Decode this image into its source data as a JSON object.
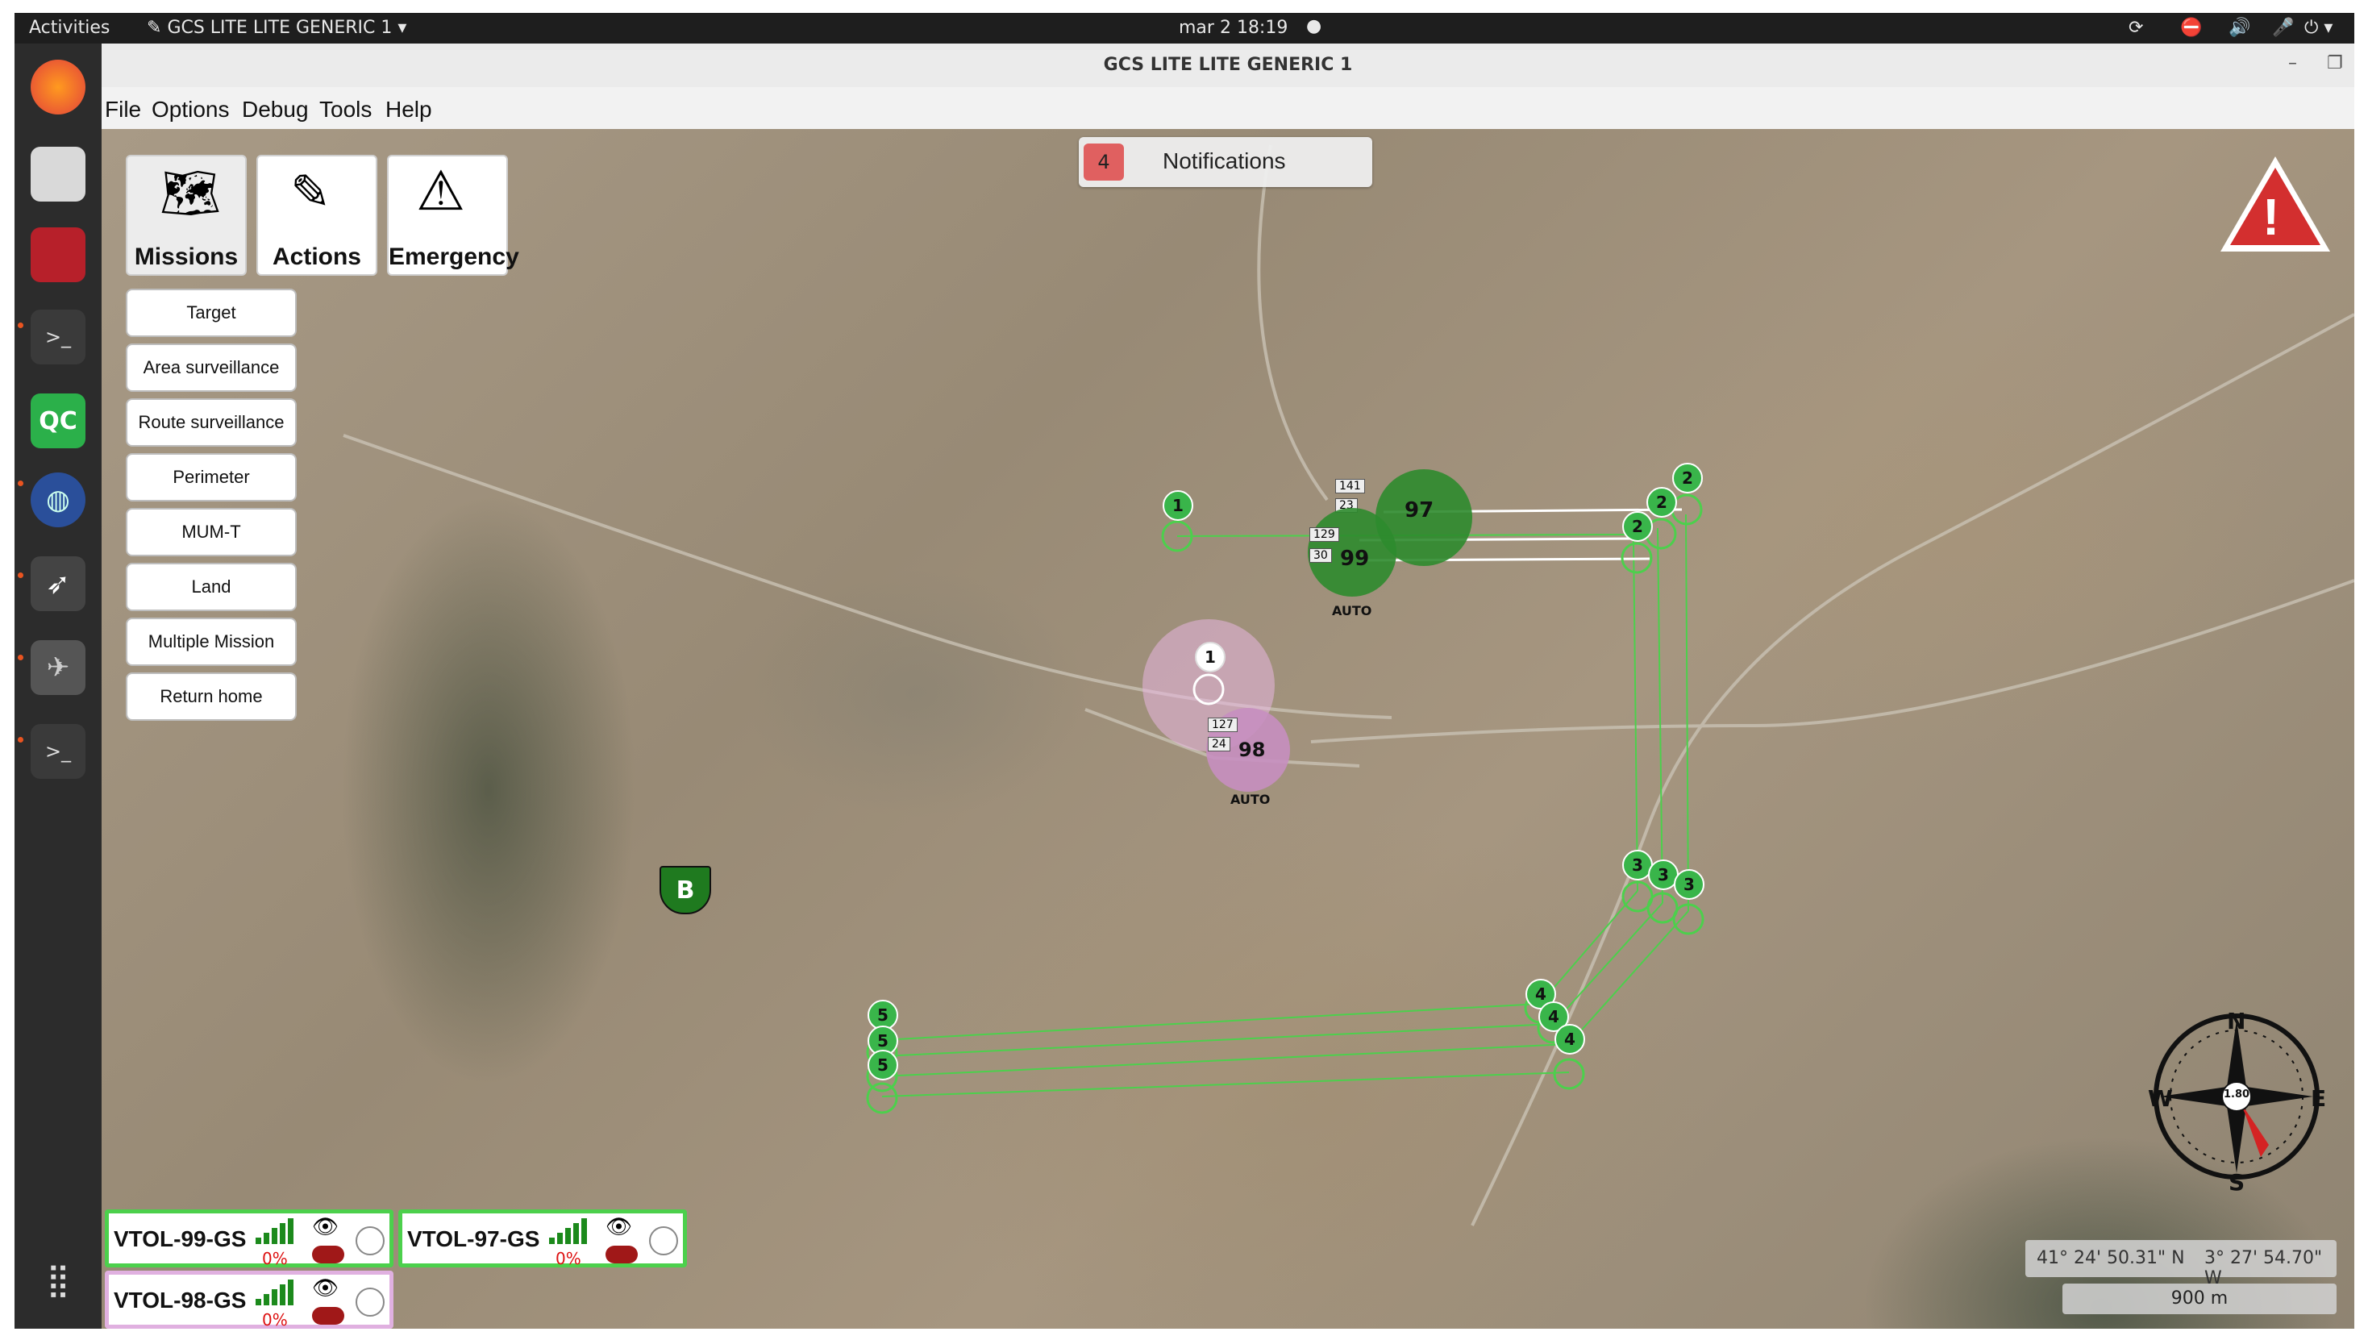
{
  "topbar": {
    "activities": "Activities",
    "app_menu": "GCS LITE LITE GENERIC 1",
    "clock": "mar 2  18:19"
  },
  "window": {
    "title": "GCS LITE LITE GENERIC 1"
  },
  "menu": [
    "File",
    "Options",
    "Debug",
    "Tools",
    "Help"
  ],
  "tool_tabs": [
    {
      "label": "Missions",
      "icon": "map-pin-icon",
      "active": true
    },
    {
      "label": "Actions",
      "icon": "edit-icon",
      "active": false
    },
    {
      "label": "Emergency",
      "icon": "warning-icon",
      "active": false
    }
  ],
  "missions": [
    "Target",
    "Area surveillance",
    "Route surveillance",
    "Perimeter",
    "MUM-T",
    "Land",
    "Multiple Mission",
    "Return home"
  ],
  "notifications": {
    "count": "4",
    "label": "Notifications"
  },
  "map": {
    "base_label": "B",
    "colors": {
      "waypoint_green": "#39b54a",
      "route_line": "#4cd04c",
      "drone_98": "#d8a9d0",
      "alert_red": "#d32f2f"
    },
    "drones": [
      {
        "id": "97",
        "tags": [
          "141",
          "23"
        ],
        "mode": "AUTO",
        "color": "#2e8b2e"
      },
      {
        "id": "99",
        "tags": [
          "129",
          "30"
        ],
        "mode": "AUTO",
        "color": "#2e8b2e"
      },
      {
        "id": "98",
        "tags": [
          "127",
          "24"
        ],
        "mode": "AUTO",
        "color": "#c78fc0"
      }
    ],
    "waypoints": [
      "1",
      "1",
      "2",
      "2",
      "2",
      "3",
      "3",
      "3",
      "4",
      "4",
      "4",
      "5",
      "5",
      "5"
    ]
  },
  "compass": {
    "n": "N",
    "s": "S",
    "e": "E",
    "w": "W",
    "value": "1.80"
  },
  "coordinates": {
    "lat": "41° 24' 50.31\" N",
    "lon": "3° 27' 54.70\" W"
  },
  "scale": "900 m",
  "vehicles": [
    {
      "name": "VTOL-99-GS",
      "battery": "0%",
      "border": "#4cd04c"
    },
    {
      "name": "VTOL-97-GS",
      "battery": "0%",
      "border": "#4cd04c"
    },
    {
      "name": "VTOL-98-GS",
      "battery": "0%",
      "border": "#e0b0e0"
    }
  ]
}
